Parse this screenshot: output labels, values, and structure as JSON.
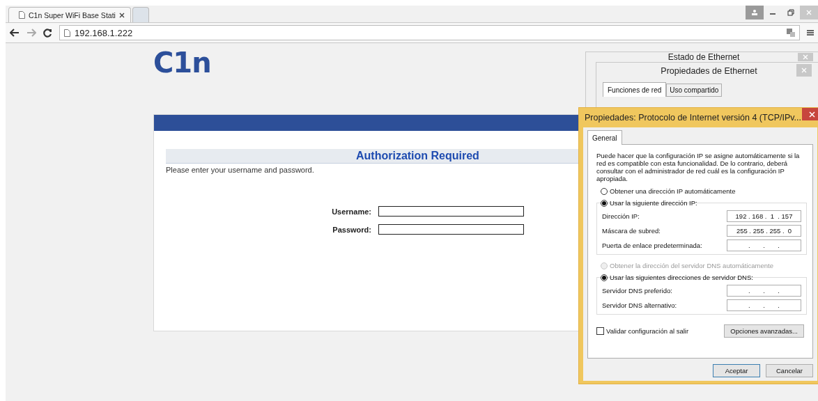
{
  "browser": {
    "tabs": [
      {
        "title": "C1n Super WiFi Base Stati",
        "selected": true
      },
      {
        "selected": false
      }
    ],
    "address": "192.168.1.222"
  },
  "page": {
    "logo": "C1n",
    "heading": "Authorization Required",
    "message": "Please enter your username and password.",
    "fields": [
      {
        "label": "Username:"
      },
      {
        "label": "Password:"
      }
    ]
  },
  "status_window": {
    "title": "Estado de Ethernet"
  },
  "ethernet_window": {
    "title": "Propiedades de Ethernet",
    "tabs": [
      {
        "label": "Funciones de red",
        "selected": true
      },
      {
        "label": "Uso compartido",
        "selected": false
      }
    ]
  },
  "ipv4_dialog": {
    "title": "Propiedades: Protocolo de Internet versión 4 (TCP/IPv...",
    "tabs": [
      {
        "label": "General",
        "selected": true
      }
    ],
    "description": "Puede hacer que la configuración IP se asigne automáticamente si la red es compatible con esta funcionalidad. De lo contrario, deberá consultar con el administrador de red cuál es la configuración IP apropiada.",
    "ip_auto": {
      "label": "Obtener una dirección IP automáticamente",
      "selected": false,
      "disabled": false
    },
    "ip_manual": {
      "label": "Usar la siguiente dirección IP:",
      "selected": true,
      "disabled": false,
      "fields": [
        {
          "label": "Dirección IP:",
          "value": "192 . 168 .  1  . 157"
        },
        {
          "label": "Máscara de subred:",
          "value": "255 . 255 . 255 .  0"
        },
        {
          "label": "Puerta de enlace predeterminada:",
          "value": ".       .       ."
        }
      ]
    },
    "dns_auto": {
      "label": "Obtener la dirección del servidor DNS automáticamente",
      "selected": false,
      "disabled": true
    },
    "dns_manual": {
      "label": "Usar las siguientes direcciones de servidor DNS:",
      "selected": true,
      "disabled": false,
      "fields": [
        {
          "label": "Servidor DNS preferido:",
          "value": ".       .       ."
        },
        {
          "label": "Servidor DNS alternativo:",
          "value": ".       .       ."
        }
      ]
    },
    "validate": {
      "label": "Validar configuración al salir",
      "checked": false
    },
    "advanced_button": "Opciones avanzadas...",
    "buttons": [
      {
        "label": "Aceptar",
        "default": true
      },
      {
        "label": "Cancelar",
        "default": false
      }
    ]
  }
}
